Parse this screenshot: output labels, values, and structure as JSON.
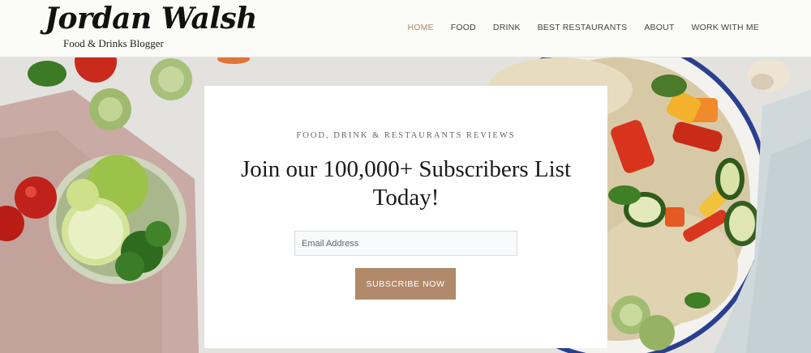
{
  "brand": {
    "name": "Jordan Walsh",
    "tagline": "Food & Drinks Blogger"
  },
  "nav": {
    "items": [
      {
        "label": "HOME",
        "active": true
      },
      {
        "label": "FOOD",
        "active": false
      },
      {
        "label": "DRINK",
        "active": false
      },
      {
        "label": "BEST RESTAURANTS",
        "active": false
      },
      {
        "label": "ABOUT",
        "active": false
      },
      {
        "label": "WORK WITH ME",
        "active": false
      }
    ]
  },
  "subscribe": {
    "eyebrow": "FOOD, DRINK & RESTAURANTS REVIEWS",
    "title": "Join our 100,000+ Subscribers List Today!",
    "email_placeholder": "Email Address",
    "email_value": "",
    "button_label": "SUBSCRIBE NOW"
  },
  "colors": {
    "accent": "#b08a6a",
    "header_bg": "#fbfbf8",
    "card_bg": "#ffffff"
  },
  "icons": {
    "hero_image": "food-salad-photo"
  }
}
